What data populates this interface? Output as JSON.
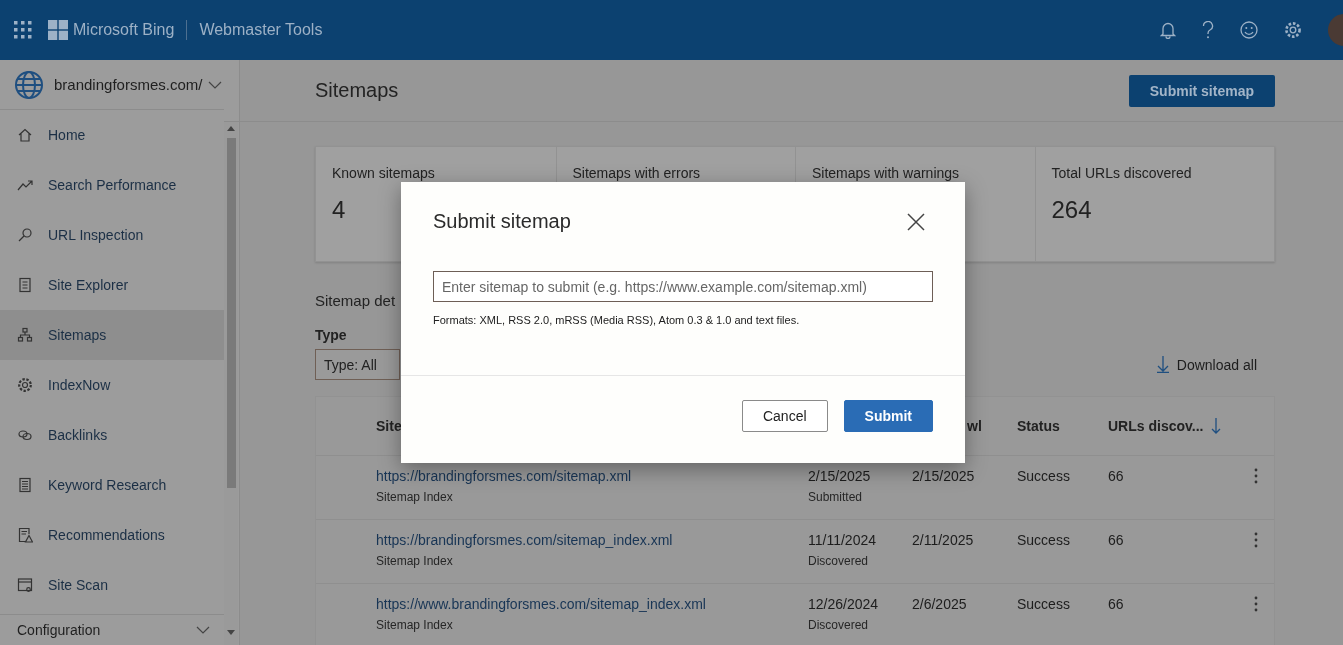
{
  "top_bar": {
    "brand": "Microsoft Bing",
    "product": "Webmaster Tools"
  },
  "site_selector": {
    "value": "brandingforsmes.com/"
  },
  "sidebar": {
    "items": [
      {
        "label": "Home",
        "kind": "home",
        "selected": false
      },
      {
        "label": "Search Performance",
        "kind": "trend",
        "selected": false
      },
      {
        "label": "URL Inspection",
        "kind": "search",
        "selected": false
      },
      {
        "label": "Site Explorer",
        "kind": "document",
        "selected": false
      },
      {
        "label": "Sitemaps",
        "kind": "sitemap",
        "selected": true
      },
      {
        "label": "IndexNow",
        "kind": "gear",
        "selected": false
      },
      {
        "label": "Backlinks",
        "kind": "link",
        "selected": false
      },
      {
        "label": "Keyword Research",
        "kind": "list",
        "selected": false
      },
      {
        "label": "Recommendations",
        "kind": "warning",
        "selected": false
      },
      {
        "label": "Site Scan",
        "kind": "scan",
        "selected": false
      }
    ],
    "section": {
      "label": "Configuration",
      "expanded": false
    }
  },
  "page": {
    "title": "Sitemaps",
    "submit_button": "Submit sitemap"
  },
  "stats": [
    {
      "label": "Known sitemaps",
      "value": "4"
    },
    {
      "label": "Sitemaps with errors"
    },
    {
      "label": "Sitemaps with warnings"
    },
    {
      "label": "Total URLs discovered",
      "value": "264"
    }
  ],
  "details": {
    "heading": "Sitemap det",
    "filter_label": "Type",
    "filter_value": "Type: All",
    "download": "Download all"
  },
  "table": {
    "columns": [
      {
        "label": "Site",
        "sorted": false
      },
      {
        "label": "wl",
        "sorted": false
      },
      {
        "label": "Status",
        "sorted": false
      },
      {
        "label": "URLs discov...",
        "sorted": true
      }
    ],
    "rows": [
      {
        "url": "https://brandingforsmes.com/sitemap.xml",
        "type": "Sitemap Index",
        "date": "2/15/2025",
        "date_note": "Submitted",
        "last_crawl": "2/15/2025",
        "status": "Success",
        "urls": "66"
      },
      {
        "url": "https://brandingforsmes.com/sitemap_index.xml",
        "type": "Sitemap Index",
        "date": "11/11/2024",
        "date_note": "Discovered",
        "last_crawl": "2/11/2025",
        "status": "Success",
        "urls": "66"
      },
      {
        "url": "https://www.brandingforsmes.com/sitemap_index.xml",
        "type": "Sitemap Index",
        "date": "12/26/2024",
        "date_note": "Discovered",
        "last_crawl": "2/6/2025",
        "status": "Success",
        "urls": "66"
      }
    ]
  },
  "modal": {
    "title": "Submit sitemap",
    "input": {
      "placeholder": "Enter sitemap to submit (e.g. https://www.example.com/sitemap.xml)"
    },
    "hint": "Formats: XML, RSS 2.0, mRSS (Media RSS), Atom 0.3 & 1.0 and text files.",
    "buttons": [
      {
        "label": "Cancel",
        "kind": "secondary"
      },
      {
        "label": "Submit",
        "kind": "primary"
      }
    ]
  }
}
